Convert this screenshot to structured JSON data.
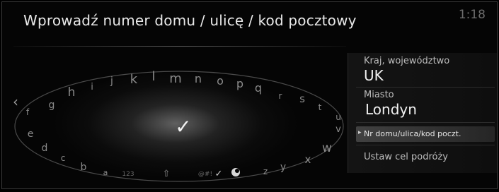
{
  "header": {
    "title": "Wprowadź numer domu / ulicę / kod pocztowy",
    "clock": "1:18"
  },
  "keyboard": {
    "letters": [
      "f",
      "g",
      "h",
      "i",
      "j",
      "k",
      "l",
      "m",
      "n",
      "o",
      "p",
      "q",
      "r",
      "s",
      "t",
      "u",
      "v",
      "w",
      "x",
      "y",
      "z",
      "a",
      "b",
      "c",
      "d",
      "e"
    ],
    "left_arrow": "‹",
    "confirm_icon": "check-icon",
    "mode_labels": {
      "numbers": "123",
      "shift": "⇧",
      "symbols": "@#!",
      "check_small": "✓"
    }
  },
  "side_panel": {
    "country_label": "Kraj, województwo",
    "country_value": "UK",
    "city_label": "Miasto",
    "city_value": "Londyn",
    "selected_item": "Nr domu/ulica/kod poczt.",
    "set_destination": "Ustaw cel podróży"
  },
  "colors": {
    "background": "#050505",
    "text": "#e8e8e8",
    "muted": "#8a8a8a"
  }
}
